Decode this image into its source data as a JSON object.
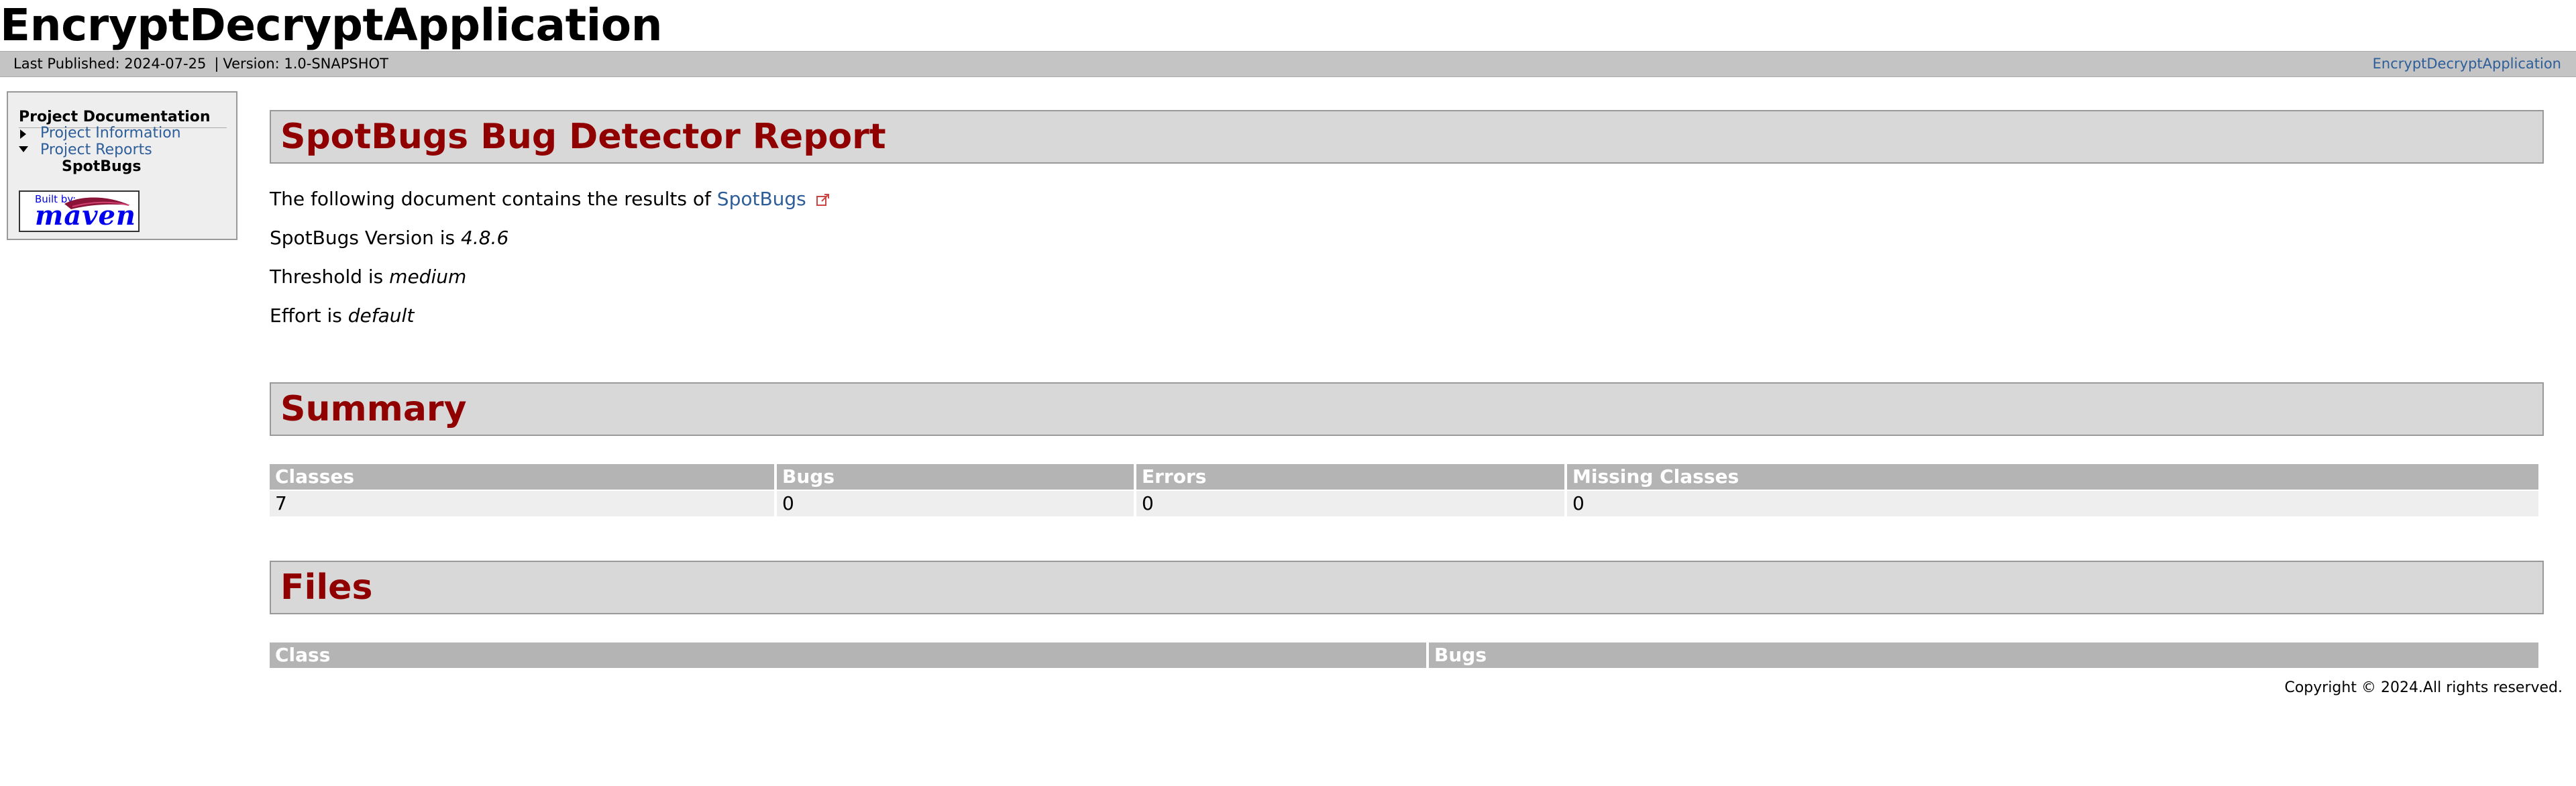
{
  "banner": {
    "title": "EncryptDecryptApplication"
  },
  "breadcrumbs": {
    "published": "Last Published: 2024-07-25",
    "separator": "|",
    "version": "Version: 1.0-SNAPSHOT",
    "project_link": "EncryptDecryptApplication"
  },
  "sidebar": {
    "heading": "Project Documentation",
    "items": [
      {
        "label": "Project Information",
        "state": "collapsed"
      },
      {
        "label": "Project Reports",
        "state": "expanded"
      },
      {
        "label": "SpotBugs",
        "state": "selected"
      }
    ],
    "built_by": {
      "prefix": "Built by:",
      "name": "maven"
    }
  },
  "main": {
    "report_title": "SpotBugs Bug Detector Report",
    "intro_text": "The following document contains the results of",
    "intro_link": "SpotBugs",
    "version_label": "SpotBugs Version is",
    "version_value": "4.8.6",
    "threshold_label": "Threshold is",
    "threshold_value": "medium",
    "effort_label": "Effort is",
    "effort_value": "default",
    "summary": {
      "title": "Summary",
      "headers": [
        "Classes",
        "Bugs",
        "Errors",
        "Missing Classes"
      ],
      "row": [
        "7",
        "0",
        "0",
        "0"
      ]
    },
    "files": {
      "title": "Files",
      "headers": [
        "Class",
        "Bugs"
      ]
    }
  },
  "footer": {
    "copyright": "Copyright © 2024.All rights reserved."
  },
  "colors": {
    "section_title": "#900000",
    "link": "#2e5e9a",
    "breadcrumb_bg": "#c4c4c4",
    "table_header_bg": "#b4b4b4"
  }
}
